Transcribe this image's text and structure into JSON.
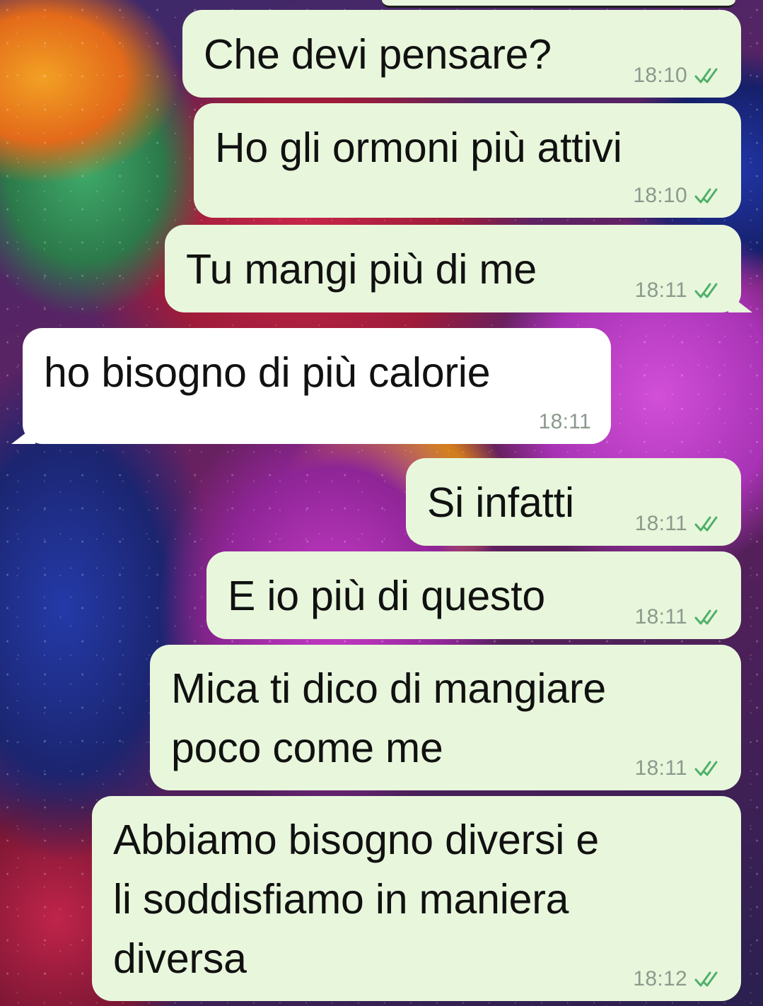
{
  "chat": {
    "messages": [
      {
        "id": "m1",
        "direction": "outgoing",
        "text": "Che devi pensare?",
        "time": "18:10",
        "status": "read"
      },
      {
        "id": "m2",
        "direction": "outgoing",
        "text": "Ho gli ormoni più attivi",
        "time": "18:10",
        "status": "read"
      },
      {
        "id": "m3",
        "direction": "outgoing",
        "text": "Tu mangi più di me",
        "time": "18:11",
        "status": "read"
      },
      {
        "id": "m4",
        "direction": "incoming",
        "text": "ho bisogno di più calorie",
        "time": "18:11"
      },
      {
        "id": "m5",
        "direction": "outgoing",
        "text": "Si infatti",
        "time": "18:11",
        "status": "read"
      },
      {
        "id": "m6",
        "direction": "outgoing",
        "text": "E io più di questo",
        "time": "18:11",
        "status": "read"
      },
      {
        "id": "m7",
        "direction": "outgoing",
        "text": "Mica ti dico di mangiare\npoco come me",
        "time": "18:11",
        "status": "read"
      },
      {
        "id": "m8",
        "direction": "outgoing",
        "text": "Abbiamo bisogno diversi e\nli soddisfiamo in maniera\ndiversa",
        "time": "18:12",
        "status": "read"
      }
    ]
  },
  "theme": {
    "outgoing_bubble": "#e8f7dc",
    "incoming_bubble": "#ffffff",
    "read_check_color": "#4fb06a",
    "time_color": "#8a9a8c"
  },
  "icons": {
    "read_receipt": "double-check-icon"
  }
}
